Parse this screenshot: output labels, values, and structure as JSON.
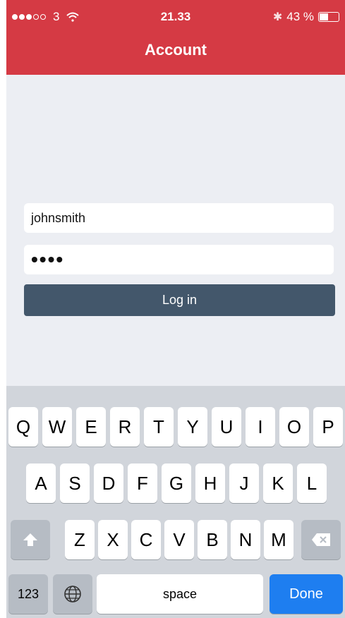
{
  "status_bar": {
    "carrier": "3",
    "time": "21.33",
    "battery_text": "43 %",
    "battery_level": 0.43
  },
  "header": {
    "title": "Account",
    "color": "#d53a44"
  },
  "form": {
    "username_value": "johnsmith",
    "password_masked": "••••",
    "login_label": "Log in"
  },
  "keyboard": {
    "row1": [
      "Q",
      "W",
      "E",
      "R",
      "T",
      "Y",
      "U",
      "I",
      "O",
      "P"
    ],
    "row2": [
      "A",
      "S",
      "D",
      "F",
      "G",
      "H",
      "J",
      "K",
      "L"
    ],
    "row3": [
      "Z",
      "X",
      "C",
      "V",
      "B",
      "N",
      "M"
    ],
    "numbers_label": "123",
    "space_label": "space",
    "done_label": "Done",
    "done_color": "#1e7ef0"
  }
}
